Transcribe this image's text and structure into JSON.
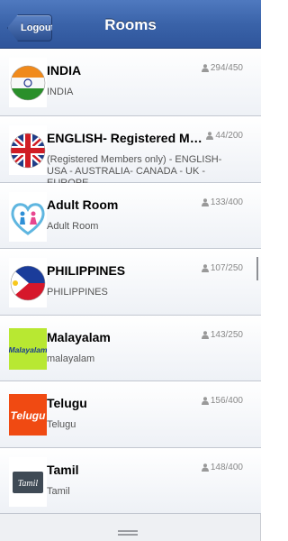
{
  "header": {
    "back_label": "Logout",
    "title": "Rooms"
  },
  "rooms": [
    {
      "name": "INDIA",
      "description": "INDIA",
      "count": "294/450",
      "icon": "india-flag-icon"
    },
    {
      "name": "ENGLISH- Registered Members ...",
      "description": "(Registered Members only) - ENGLISH- USA - AUSTRALIA- CANADA - UK - EUROPE",
      "count": "44/200",
      "icon": "uk-flag-icon"
    },
    {
      "name": "Adult Room",
      "description": "Adult Room",
      "count": "133/400",
      "icon": "couple-heart-icon"
    },
    {
      "name": "PHILIPPINES",
      "description": "PHILIPPINES",
      "count": "107/250",
      "icon": "philippines-flag-icon"
    },
    {
      "name": "Malayalam",
      "description": "malayalam",
      "count": "143/250",
      "icon": "malayalam-logo-icon",
      "logo_text": "Malayalam"
    },
    {
      "name": "Telugu",
      "description": "Telugu",
      "count": "156/400",
      "icon": "telugu-logo-icon",
      "logo_text": "Telugu"
    },
    {
      "name": "Tamil",
      "description": "Tamil",
      "count": "148/400",
      "icon": "tamil-logo-icon",
      "logo_text": "Tamil"
    }
  ],
  "colors": {
    "header": "#3a63a9",
    "accent_green": "#b8e832",
    "accent_orange": "#f04a12"
  }
}
